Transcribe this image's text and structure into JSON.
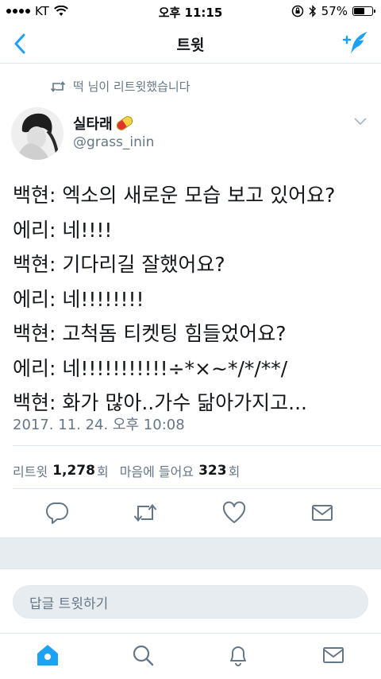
{
  "status_bar": {
    "carrier": "KT",
    "time": "오후 11:15",
    "battery": "57%",
    "battery_level": 0.57
  },
  "nav": {
    "title": "트윗"
  },
  "retweet_context": "떡 님이 리트윗했습니다",
  "tweet": {
    "author_name": "실타래",
    "author_handle": "@grass_inin",
    "lines": [
      "백현: 엑소의 새로운 모습 보고 있어요?",
      "에리: 네!!!!",
      "백현: 기다리길 잘했어요?",
      "에리: 네!!!!!!!!",
      "백현: 고척돔 티켓팅 힘들었어요?",
      "에리: 네!!!!!!!!!!!÷*×~*/*/**/",
      "백현: 화가 많아..가수 닮아가지고..."
    ],
    "timestamp": "2017. 11. 24. 오후 10:08",
    "retweet_label": "리트윗",
    "retweet_count": "1,278",
    "like_label_prefix": "마음에 들어요",
    "like_count": "323",
    "count_suffix": "회"
  },
  "reply": {
    "placeholder": "답글 트윗하기"
  },
  "colors": {
    "accent": "#1da1f2",
    "muted": "#657786",
    "text": "#14171a",
    "divider": "#e1e8ed"
  },
  "icons": {
    "nav_back": "chevron-left-icon",
    "nav_compose": "compose-tweet-icon",
    "reply": "reply-icon",
    "retweet": "retweet-icon",
    "like": "heart-icon",
    "dm": "envelope-icon",
    "tab_home": "home-icon",
    "tab_search": "search-icon",
    "tab_notifications": "bell-icon",
    "tab_messages": "envelope-icon"
  }
}
